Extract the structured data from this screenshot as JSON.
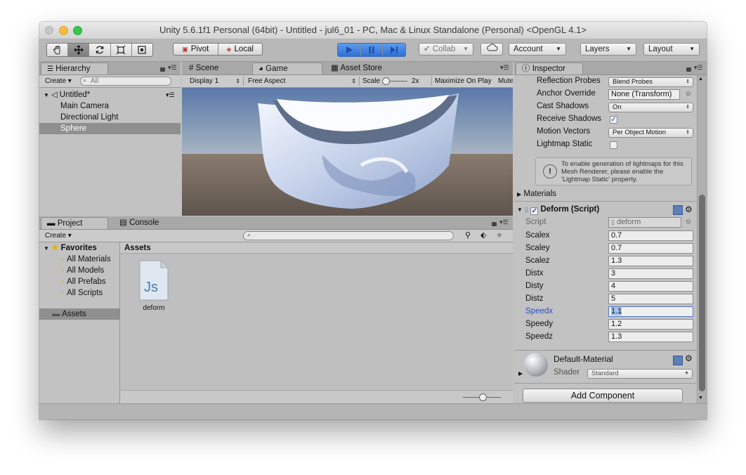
{
  "window": {
    "title": "Unity 5.6.1f1 Personal (64bit) - Untitled - jul6_01 - PC, Mac & Linux Standalone (Personal) <OpenGL 4.1>"
  },
  "toolbar": {
    "pivot": "Pivot",
    "local": "Local",
    "collab": "Collab",
    "account": "Account",
    "layers": "Layers",
    "layout": "Layout"
  },
  "hierarchy": {
    "tab": "Hierarchy",
    "create": "Create",
    "search_placeholder": "All",
    "scene": "Untitled*",
    "items": [
      "Main Camera",
      "Directional Light",
      "Sphere"
    ],
    "selected_index": 2
  },
  "view_tabs": {
    "scene": "Scene",
    "game": "Game",
    "asset_store": "Asset Store"
  },
  "game_bar": {
    "display": "Display 1",
    "aspect": "Free Aspect",
    "scale_label": "Scale",
    "scale_value": "2x",
    "maximize": "Maximize On Play",
    "mute": "Mute"
  },
  "project": {
    "tab": "Project",
    "console_tab": "Console",
    "create": "Create",
    "favorites_label": "Favorites",
    "favorites": [
      "All Materials",
      "All Models",
      "All Prefabs",
      "All Scripts"
    ],
    "assets_folder": "Assets",
    "assets_header": "Assets",
    "asset_items": [
      {
        "name": "deform",
        "icon_text": "Js"
      }
    ]
  },
  "inspector": {
    "tab": "Inspector",
    "renderer_props": [
      {
        "label": "Reflection Probes",
        "kind": "popup",
        "value": "Blend Probes"
      },
      {
        "label": "Anchor Override",
        "kind": "object",
        "value": "None (Transform)"
      },
      {
        "label": "Cast Shadows",
        "kind": "popup",
        "value": "On"
      },
      {
        "label": "Receive Shadows",
        "kind": "check",
        "value": "✓"
      },
      {
        "label": "Motion Vectors",
        "kind": "popup",
        "value": "Per Object Motion"
      },
      {
        "label": "Lightmap Static",
        "kind": "check",
        "value": ""
      }
    ],
    "info_text": "To enable generation of lightmaps for this Mesh Renderer, please enable the 'Lightmap Static' property.",
    "materials_label": "Materials",
    "component_title": "Deform (Script)",
    "script_label": "Script",
    "script_value": "deform",
    "fields": [
      {
        "label": "Scalex",
        "value": "0.7"
      },
      {
        "label": "Scaley",
        "value": "0.7"
      },
      {
        "label": "Scalez",
        "value": "1.3"
      },
      {
        "label": "Distx",
        "value": "3"
      },
      {
        "label": "Disty",
        "value": "4"
      },
      {
        "label": "Distz",
        "value": "5"
      },
      {
        "label": "Speedx",
        "value": "1.1"
      },
      {
        "label": "Speedy",
        "value": "1.2"
      },
      {
        "label": "Speedz",
        "value": "1.3"
      }
    ],
    "active_field_index": 6,
    "material_name": "Default-Material",
    "shader_label": "Shader",
    "shader_value": "Standard",
    "add_component": "Add Component"
  },
  "colors": {
    "play_blue": "#3d7ddf",
    "selection": "#8f8f8f",
    "active_label": "#2a4fc6",
    "sky_top": "#5a78a8",
    "ground": "#7c6d63"
  }
}
